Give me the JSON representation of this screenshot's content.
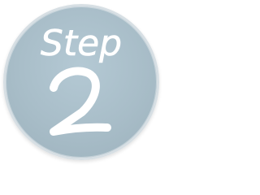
{
  "badge": {
    "label": "Step",
    "number": "2",
    "colors": {
      "fill": "#a8bdc8",
      "rim": "#d7dfe4",
      "text": "#ffffff"
    }
  }
}
